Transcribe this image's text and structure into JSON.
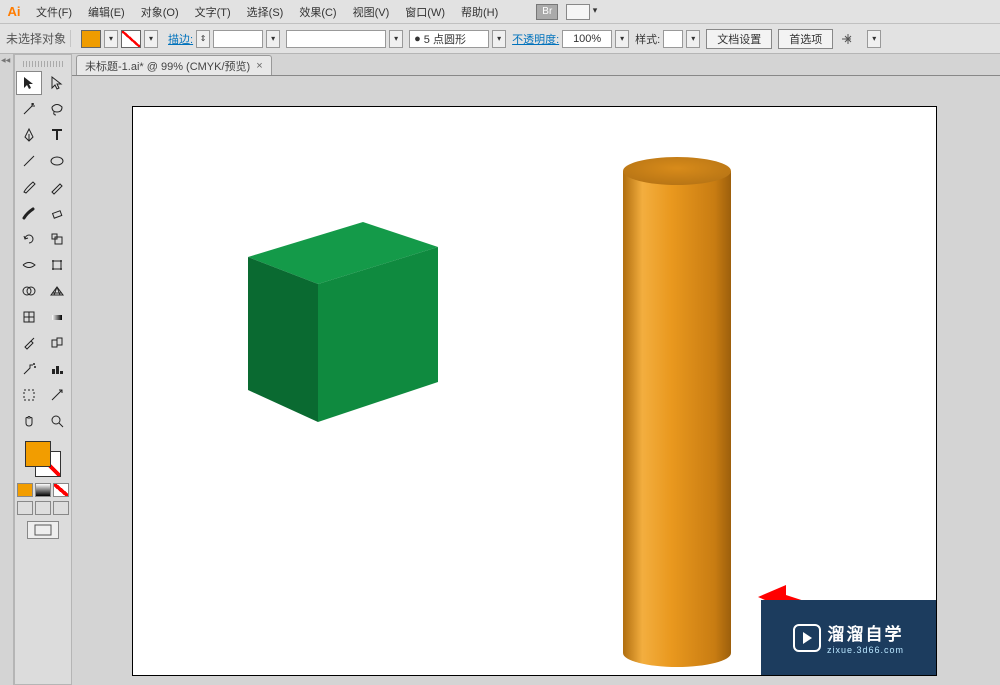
{
  "app_icon": "Ai",
  "menu": [
    "文件(F)",
    "编辑(E)",
    "对象(O)",
    "文字(T)",
    "选择(S)",
    "效果(C)",
    "视图(V)",
    "窗口(W)",
    "帮助(H)"
  ],
  "br_label": "Br",
  "control": {
    "noselect": "未选择对象",
    "fill_color": "#ef9c00",
    "stroke_label": "描边:",
    "stroke_width": "",
    "stroke_profile": "",
    "brush_value": "5 点圆形",
    "brush_bullet": "●",
    "opacity_label": "不透明度:",
    "opacity_value": "100%",
    "style_label": "样式:",
    "docsetup": "文档设置",
    "prefs": "首选项"
  },
  "tab": {
    "title": "未标题-1.ai* @ 99% (CMYK/预览)",
    "close": "×"
  },
  "tools": {
    "row1": [
      "selection",
      "direct-selection"
    ],
    "row2": [
      "magic-wand",
      "lasso"
    ],
    "row3": [
      "pen",
      "type"
    ],
    "row4": [
      "line",
      "ellipse"
    ],
    "row5": [
      "paintbrush",
      "pencil"
    ],
    "row6": [
      "blob-brush",
      "eraser"
    ],
    "row7": [
      "rotate",
      "scale"
    ],
    "row8": [
      "width",
      "free-transform"
    ],
    "row9": [
      "shape-builder",
      "perspective"
    ],
    "row10": [
      "mesh",
      "gradient"
    ],
    "row11": [
      "eyedropper",
      "blend"
    ],
    "row12": [
      "symbol-sprayer",
      "column-graph"
    ],
    "row13": [
      "artboard",
      "slice"
    ],
    "row14": [
      "hand",
      "zoom"
    ]
  },
  "colors": {
    "fill": "#f29d00",
    "cube_top": "#149a49",
    "cube_front": "#0f8a3f",
    "cube_side": "#0a6a31",
    "cylinder": "#e9981e",
    "arrow": "#ff0000",
    "watermark_bg": "#1c3c5e"
  },
  "watermark": {
    "main": "溜溜自学",
    "sub": "zixue.3d66.com"
  }
}
